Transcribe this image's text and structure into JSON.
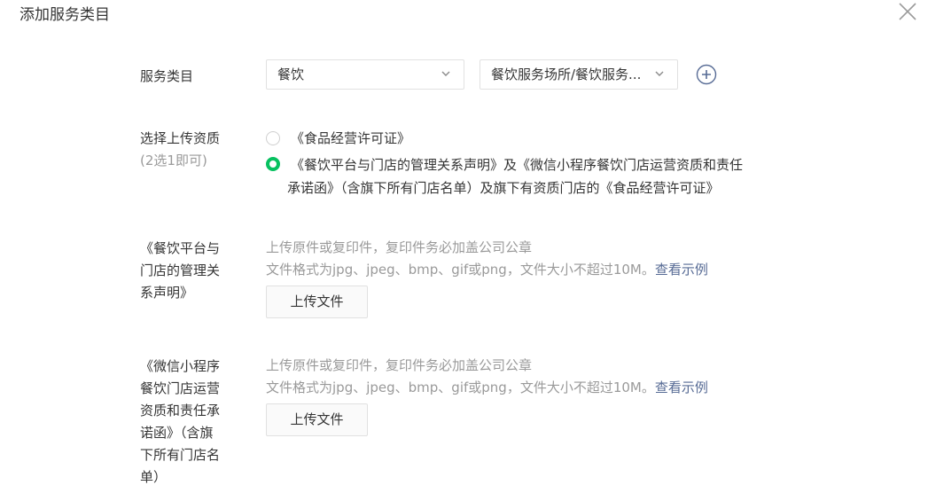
{
  "dialog": {
    "title": "添加服务类目"
  },
  "category": {
    "label": "服务类目",
    "primary_value": "餐饮",
    "secondary_value": "餐饮服务场所/餐饮服务..."
  },
  "qualification": {
    "label": "选择上传资质",
    "sublabel": "(2选1即可)",
    "options": [
      {
        "line1": "《食品经营许可证》",
        "line2": "",
        "selected": false
      },
      {
        "line1": "《餐饮平台与门店的管理关系声明》及《微信小程序餐饮门店运营资质和责任",
        "line2": "承诺函》（含旗下所有门店名单）及旗下有资质门店的《食品经营许可证》",
        "selected": true
      }
    ]
  },
  "uploads": [
    {
      "label_lines": [
        "《餐饮平台与",
        "门店的管理关",
        "系声明》"
      ],
      "hint1": "上传原件或复印件，复印件务必加盖公司公章",
      "hint2": "文件格式为jpg、jpeg、bmp、gif或png，文件大小不超过10M。",
      "link": "查看示例",
      "button": "上传文件"
    },
    {
      "label_lines": [
        "《微信小程序",
        "餐饮门店运营",
        "资质和责任承",
        "诺函》（含旗",
        "下所有门店名",
        "单）"
      ],
      "hint1": "上传原件或复印件，复印件务必加盖公司公章",
      "hint2": "文件格式为jpg、jpeg、bmp、gif或png，文件大小不超过10M。",
      "link": "查看示例",
      "button": "上传文件"
    }
  ],
  "colors": {
    "accent": "#07c160",
    "link": "#576b95",
    "muted": "#9a9a9a"
  }
}
